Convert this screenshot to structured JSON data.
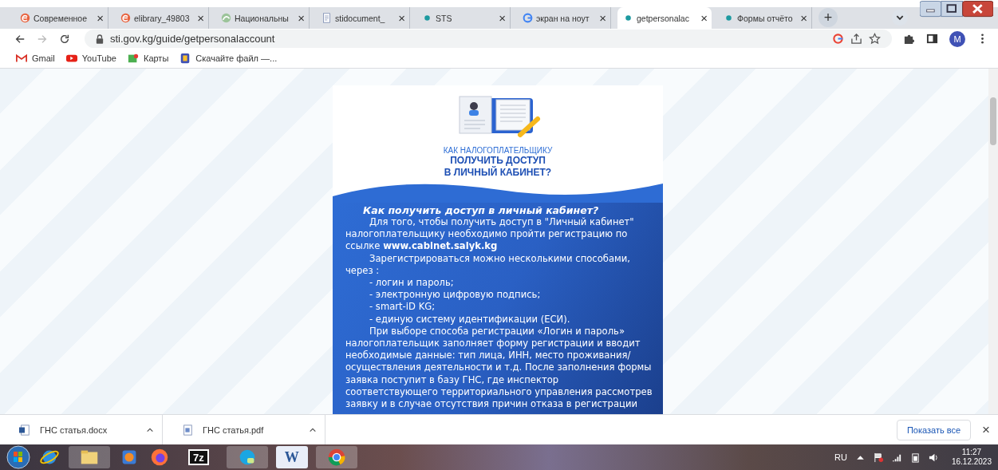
{
  "browser": {
    "tabs": [
      {
        "title": "Современное",
        "kind": "e",
        "selected": false
      },
      {
        "title": "elibrary_49803",
        "kind": "e",
        "selected": false
      },
      {
        "title": "Национальны",
        "kind": "leaf",
        "selected": false
      },
      {
        "title": "stidocument_",
        "kind": "doc",
        "selected": false
      },
      {
        "title": "STS",
        "kind": "sts",
        "selected": false
      },
      {
        "title": "экран на ноут",
        "kind": "g",
        "selected": false
      },
      {
        "title": "getpersonalac",
        "kind": "sts",
        "selected": true
      },
      {
        "title": "Формы отчёто",
        "kind": "sts",
        "selected": false
      }
    ],
    "tab_close": "×",
    "new_tab": "+",
    "address": "sti.gov.kg/guide/getpersonalaccount",
    "profile": "M",
    "bookmarks": [
      {
        "label": "Gmail",
        "kind": "gmail"
      },
      {
        "label": "YouTube",
        "kind": "youtube"
      },
      {
        "label": "Карты",
        "kind": "maps"
      },
      {
        "label": "Скачайте файл —...",
        "kind": "file"
      }
    ]
  },
  "page": {
    "kicker": "КАК НАЛОГОПЛАТЕЛЬЩИКУ",
    "headline": [
      "ПОЛУЧИТЬ ДОСТУП",
      "В ЛИЧНЫЙ КАБИНЕТ?"
    ],
    "heading": "Как получить доступ в личный кабинет?",
    "paragraphs": [
      {
        "kind": "indent",
        "text": "Для того, чтобы получить доступ в \"Личный кабинет\" налогоплательщику необходимо пройти регистрацию по ссылке **www.cabinet.salyk.kg**"
      },
      {
        "kind": "indent",
        "text": "Зарегистрироваться можно несколькими способами, через :"
      },
      {
        "kind": "item",
        "text": "- логин и пароль;"
      },
      {
        "kind": "item",
        "text": "- электронную цифровую подпись;"
      },
      {
        "kind": "item",
        "text": "- smart-iD KG;"
      },
      {
        "kind": "item",
        "text": "- единую систему идентификации (ЕСИ)."
      },
      {
        "kind": "indent",
        "text": "При выборе способа регистрации «Логин и пароль» налогоплательщик заполняет форму регистрации и вводит необходимые данные: тип лица, ИНН, место проживания/осуществления деятельности и т.д. После заполнения формы заявка поступит в базу ГНС, где инспектор соответствующего территориального управления рассмотрев заявку и в случае отсутствия причин отказа в регистрации"
      }
    ]
  },
  "downloads": {
    "items": [
      {
        "name": "ГНС статья.docx",
        "kind": "word"
      },
      {
        "name": "ГНС статья.pdf",
        "kind": "pdf"
      }
    ],
    "show_all": "Показать все",
    "close": "×"
  },
  "taskbar": {
    "apps": [
      {
        "kind": "start"
      },
      {
        "kind": "ie"
      },
      {
        "kind": "explorer"
      },
      {
        "kind": "media"
      },
      {
        "kind": "firefox"
      },
      {
        "kind": "archiver",
        "label": "7z"
      },
      {
        "kind": "skype"
      },
      {
        "kind": "word",
        "label": "W"
      },
      {
        "kind": "chrome"
      }
    ],
    "language": "RU",
    "time": "11:27",
    "date": "16.12.2023"
  }
}
